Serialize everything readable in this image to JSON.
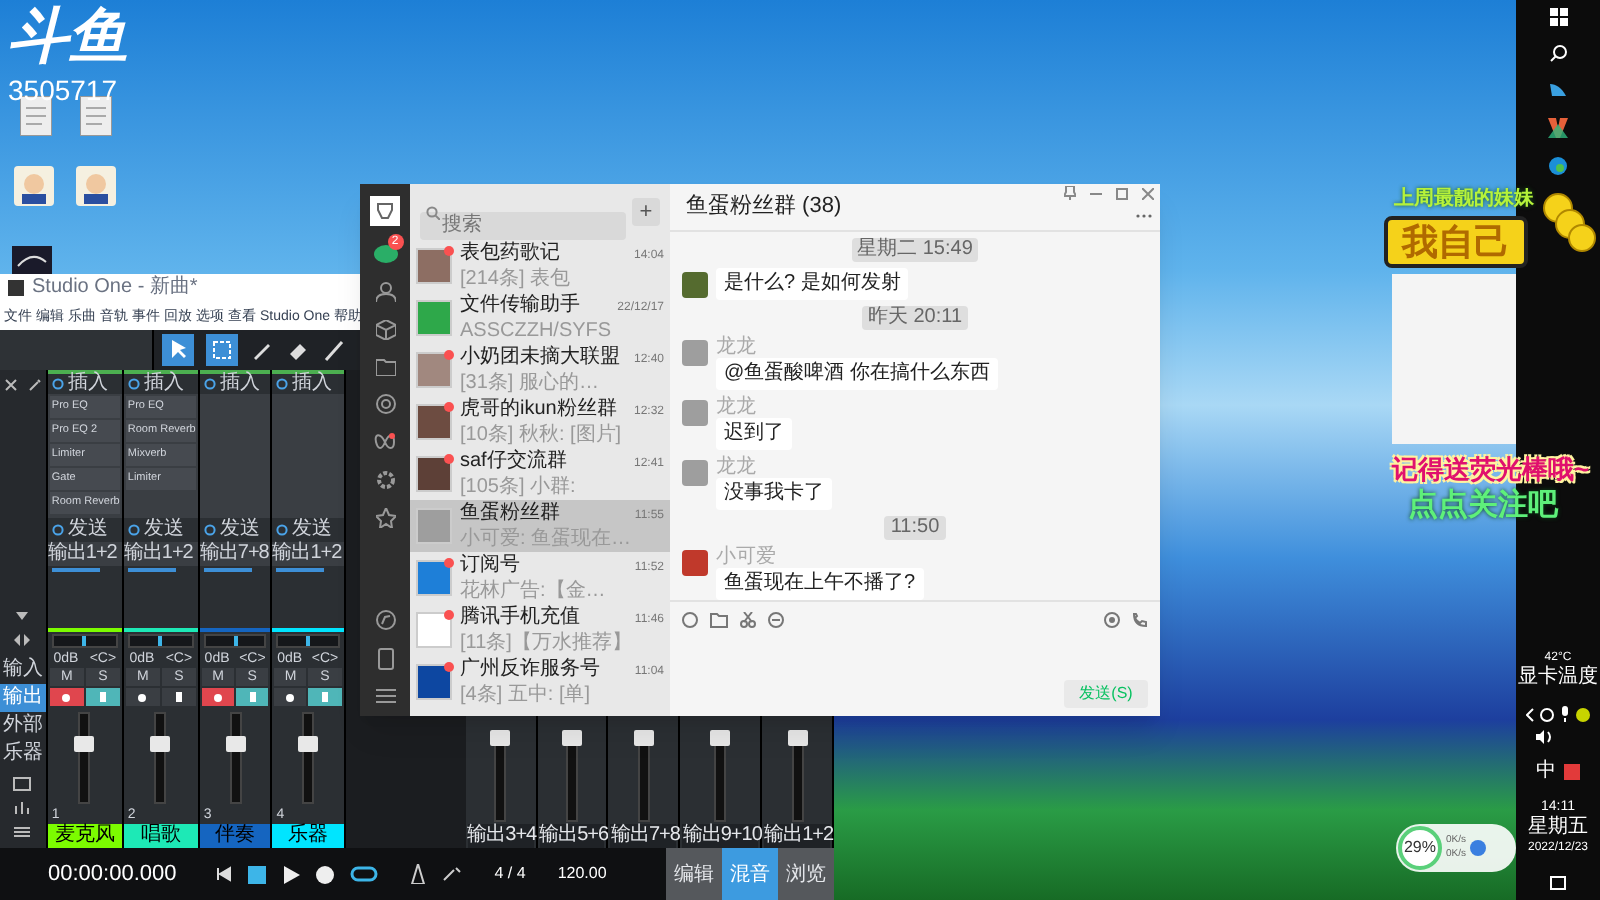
{
  "stream_overlay": {
    "logo": "斗鱼",
    "room_number": "3505717",
    "banner_caption": "上周最靓的妹妹",
    "banner_title": "我自己",
    "reminder": "记得送荧光棒哦~",
    "follow_prompt": "点点关注吧"
  },
  "studio_one": {
    "title": "Studio One - 新曲*",
    "menu": [
      "文件",
      "编辑",
      "乐曲",
      "音轨",
      "事件",
      "回放",
      "选项",
      "查看",
      "Studio One",
      "帮助"
    ],
    "side_tabs": [
      {
        "label": "输入",
        "selected": false
      },
      {
        "label": "输出",
        "selected": true
      },
      {
        "label": "外部",
        "selected": false
      },
      {
        "label": "乐器",
        "selected": false
      }
    ],
    "channels": [
      {
        "number": "1",
        "insert_label": "插入",
        "inserts": [
          "Pro EQ",
          "Pro EQ 2",
          "Limiter",
          "Gate",
          "Room Reverb"
        ],
        "send_label": "发送",
        "send": "输出1+2",
        "volume": "0dB",
        "pan": "<C>",
        "pan_slider": {
          "level": 0.5
        },
        "mute": "M",
        "solo": "S",
        "record": true,
        "monitor": true,
        "level": 0.62,
        "name": "麦克风",
        "color": "#7cfc00"
      },
      {
        "number": "2",
        "insert_label": "插入",
        "inserts": [
          "Pro EQ",
          "Room Reverb",
          "Mixverb",
          "Limiter"
        ],
        "send_label": "发送",
        "send": "输出1+2",
        "volume": "0dB",
        "pan": "<C>",
        "pan_slider": {
          "level": 0.5
        },
        "mute": "M",
        "solo": "S",
        "record": false,
        "monitor": false,
        "level": 0.62,
        "name": "唱歌",
        "color": "#1de9b6"
      },
      {
        "number": "3",
        "insert_label": "插入",
        "send_label": "发送",
        "send": "输出7+8",
        "volume": "0dB",
        "pan": "<C>",
        "pan_slider": {
          "level": 0.5
        },
        "mute": "M",
        "solo": "S",
        "record": true,
        "monitor": true,
        "level": 0.62,
        "name": "伴奏",
        "color": "#1565c0"
      },
      {
        "number": "4",
        "insert_label": "插入",
        "send_label": "发送",
        "send": "输出1+2",
        "volume": "0dB",
        "pan": "<C>",
        "pan_slider": {
          "level": 0.5
        },
        "mute": "M",
        "solo": "S",
        "record": false,
        "monitor": true,
        "level": 0.62,
        "name": "乐器",
        "color": "#00e5ff"
      }
    ],
    "outputs": [
      {
        "label": "输出3+4",
        "level": 0.9
      },
      {
        "label": "输出5+6",
        "level": 0.9
      },
      {
        "label": "输出7+8",
        "level": 0.9
      },
      {
        "label": "输出9+10",
        "level": 0.9
      },
      {
        "label": "输出1+2",
        "level": 0.9
      }
    ],
    "transport": {
      "time": "00:00:00.000",
      "signature": "4 / 4",
      "tempo": "120.00"
    },
    "views": [
      {
        "label": "编辑",
        "selected": false
      },
      {
        "label": "混音",
        "selected": true
      },
      {
        "label": "浏览",
        "selected": false
      }
    ]
  },
  "wechat": {
    "chat_badge": "2",
    "search": {
      "placeholder": "搜索"
    },
    "add_button": "+",
    "chats": [
      {
        "name": "表包药歌记",
        "preview": "[214条] 表包",
        "time": "14:04",
        "unread": true,
        "selected": false,
        "color": "#8d6e63"
      },
      {
        "name": "文件传输助手",
        "preview": "ASSCZZH/SYFS",
        "time": "22/12/17",
        "unread": false,
        "selected": false,
        "color": "#2ea84a"
      },
      {
        "name": "小奶团未摘大联盟",
        "preview": "[31条] 服心的…",
        "time": "12:40",
        "unread": true,
        "selected": false,
        "color": "#a1887f"
      },
      {
        "name": "虎哥的ikun粉丝群",
        "preview": "[10条] 秋秋: [图片]",
        "time": "12:32",
        "unread": true,
        "selected": false,
        "color": "#6d4c41"
      },
      {
        "name": "saf仔交流群",
        "preview": "[105条] 小群:",
        "time": "12:41",
        "unread": true,
        "selected": false,
        "color": "#5d4037"
      },
      {
        "name": "鱼蛋粉丝群",
        "preview": "小可爱: 鱼蛋现在…",
        "time": "11:55",
        "unread": false,
        "selected": true,
        "color": "#9e9e9e"
      },
      {
        "name": "订阅号",
        "preview": "花林广告:【金…",
        "time": "11:52",
        "unread": true,
        "selected": false,
        "color": "#1e7fd8"
      },
      {
        "name": "腾讯手机充值",
        "preview": "[11条]【万水推荐】",
        "time": "11:46",
        "unread": true,
        "selected": false,
        "color": "#ffffff"
      },
      {
        "name": "广州反诈服务号",
        "preview": "[4条] 五中: [单]",
        "time": "11:04",
        "unread": true,
        "selected": false,
        "color": "#0d47a1"
      }
    ],
    "conversation": {
      "title": "鱼蛋粉丝群 (38)",
      "messages": [
        {
          "kind": "time",
          "text": "星期二 15:49"
        },
        {
          "kind": "message",
          "text": "是什么? 是如何发射",
          "color": "#556b2f"
        },
        {
          "kind": "time",
          "text": "昨天 20:11"
        },
        {
          "kind": "message",
          "sender": "龙龙",
          "text": "@鱼蛋酸啤酒 你在搞什么东西",
          "color": "#9e9e9e"
        },
        {
          "kind": "message",
          "sender": "龙龙",
          "text": "迟到了",
          "color": "#9e9e9e"
        },
        {
          "kind": "message",
          "sender": "龙龙",
          "text": "没事我卡了",
          "color": "#9e9e9e"
        },
        {
          "kind": "time",
          "text": "11:50"
        },
        {
          "kind": "message",
          "sender": "小可爱",
          "text": "鱼蛋现在上午不播了?",
          "color": "#c0392b"
        }
      ],
      "send_button": "发送(S)"
    }
  },
  "taskbar": {
    "temperature": "42°C",
    "temperature_label": "显卡温度",
    "input_method": "中",
    "time": "14:11",
    "weekday": "星期五",
    "date": "2022/12/23"
  },
  "network_widget": {
    "usage": "29%",
    "upload": "0K/s",
    "download": "0K/s"
  }
}
